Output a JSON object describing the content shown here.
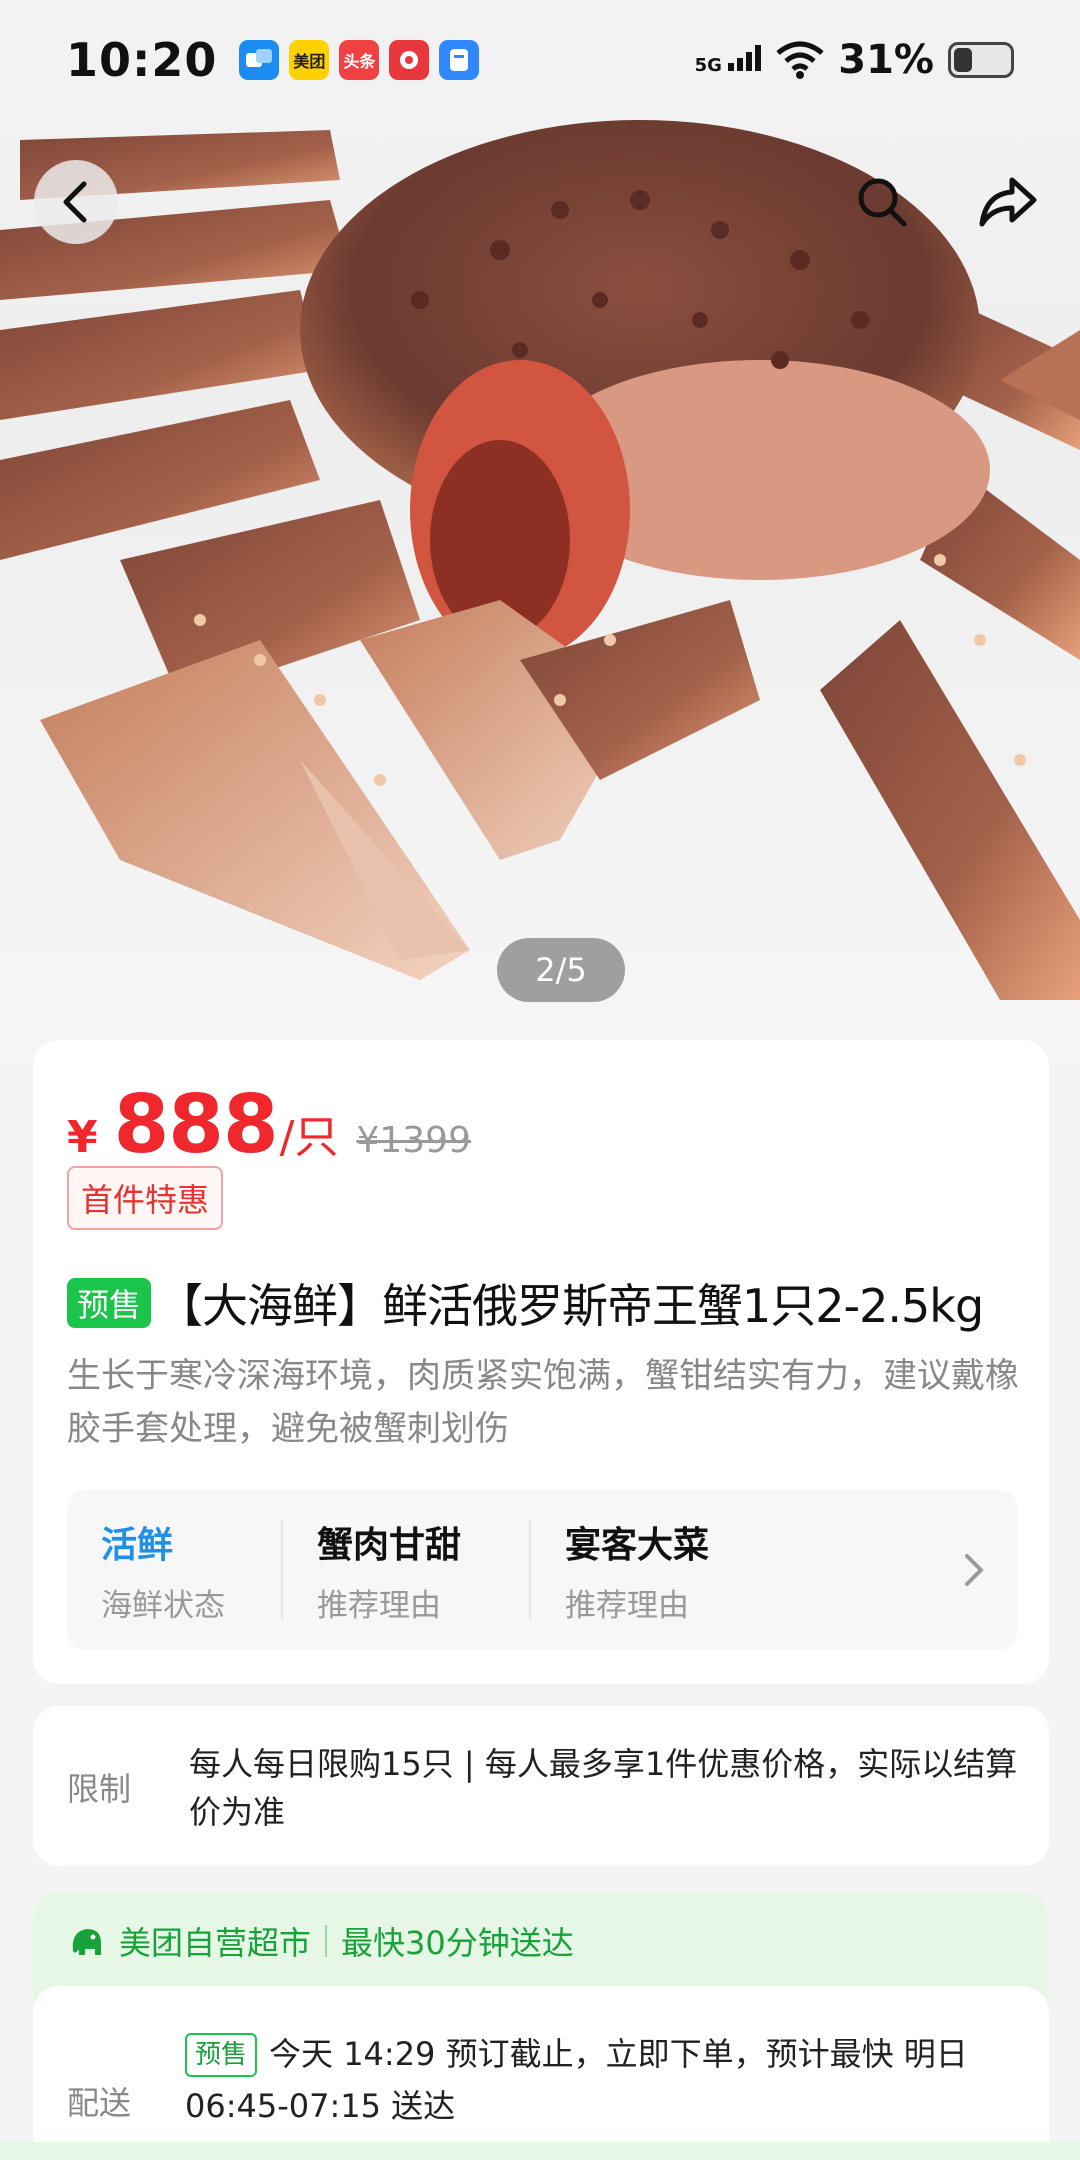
{
  "status_bar": {
    "time": "10:20",
    "notification_icons": [
      {
        "name": "app-icon-blue",
        "label": "",
        "color": "#1c8cf3"
      },
      {
        "name": "meituan-app-icon",
        "label": "美团",
        "color": "#ffd100"
      },
      {
        "name": "toutiao-app-icon",
        "label": "头条",
        "color": "#f04142"
      },
      {
        "name": "shopping-app-icon",
        "label": "",
        "color": "#e8373d"
      },
      {
        "name": "doc-app-icon",
        "label": "",
        "color": "#2f88ff"
      }
    ],
    "network": "5G",
    "battery_pct": "31%"
  },
  "gallery": {
    "page_indicator": "2/5",
    "icons": {
      "back": "back-arrow-icon",
      "search": "search-icon",
      "share": "share-icon"
    }
  },
  "price": {
    "currency": "¥",
    "amount": "888",
    "unit": "/只",
    "original": "¥1399",
    "promo_tag": "首件特惠"
  },
  "product": {
    "presale_tag": "预售",
    "title": "【大海鲜】鲜活俄罗斯帝王蟹1只2-2.5kg",
    "description": "生长于寒冷深海环境，肉质紧实饱满，蟹钳结实有力，建议戴橡胶手套处理，避免被蟹刺划伤"
  },
  "attributes": [
    {
      "value": "活鲜",
      "label": "海鲜状态"
    },
    {
      "value": "蟹肉甘甜",
      "label": "推荐理由"
    },
    {
      "value": "宴客大菜",
      "label": "推荐理由"
    }
  ],
  "limit": {
    "label": "限制",
    "text": "每人每日限购15只 | 每人最多享1件优惠价格，实际以结算价为准"
  },
  "store": {
    "name": "美团自营超市",
    "delivery_promise": "最快30分钟送达",
    "icon": "elephant-logo-icon"
  },
  "delivery": {
    "label": "配送",
    "presale_tag": "预售",
    "text": "今天 14:29 预订截止，立即下单，预计最快 明日 06:45-07:15 送达"
  },
  "colors": {
    "price_red": "#f0282d",
    "brand_green": "#1bc44a",
    "attr_blue": "#1e90e8"
  }
}
